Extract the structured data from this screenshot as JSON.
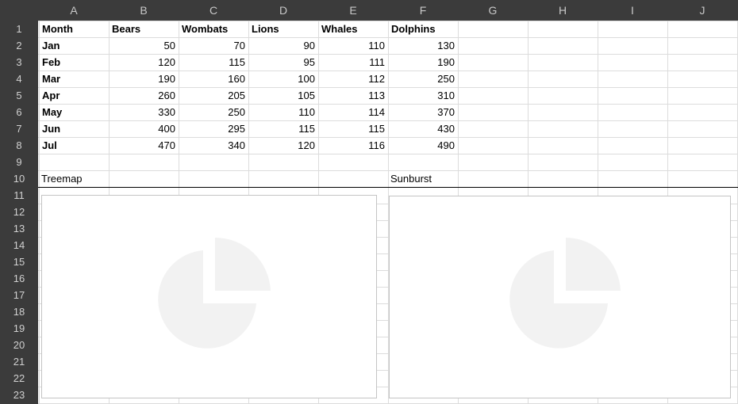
{
  "columns": [
    "A",
    "B",
    "C",
    "D",
    "E",
    "F",
    "G",
    "H",
    "I",
    "J"
  ],
  "rows": [
    "1",
    "2",
    "3",
    "4",
    "5",
    "6",
    "7",
    "8",
    "9",
    "10",
    "11",
    "12",
    "13",
    "14",
    "15",
    "16",
    "17",
    "18",
    "19",
    "20",
    "21",
    "22",
    "23"
  ],
  "table": {
    "headers": [
      "Month",
      "Bears",
      "Wombats",
      "Lions",
      "Whales",
      "Dolphins"
    ],
    "data": [
      [
        "Jan",
        "50",
        "70",
        "90",
        "110",
        "130"
      ],
      [
        "Feb",
        "120",
        "115",
        "95",
        "111",
        "190"
      ],
      [
        "Mar",
        "190",
        "160",
        "100",
        "112",
        "250"
      ],
      [
        "Apr",
        "260",
        "205",
        "105",
        "113",
        "310"
      ],
      [
        "May",
        "330",
        "250",
        "110",
        "114",
        "370"
      ],
      [
        "Jun",
        "400",
        "295",
        "115",
        "115",
        "430"
      ],
      [
        "Jul",
        "470",
        "340",
        "120",
        "116",
        "490"
      ]
    ]
  },
  "labels": {
    "treemap": "Treemap",
    "sunburst": "Sunburst"
  },
  "charts": {
    "placeholder_icon": "pie-chart-icon",
    "placeholder_color": "#f2f2f2"
  },
  "colors": {
    "header_bg": "#3b3b3b",
    "header_text": "#c8c8c8",
    "gridline": "#dcdcdc"
  }
}
